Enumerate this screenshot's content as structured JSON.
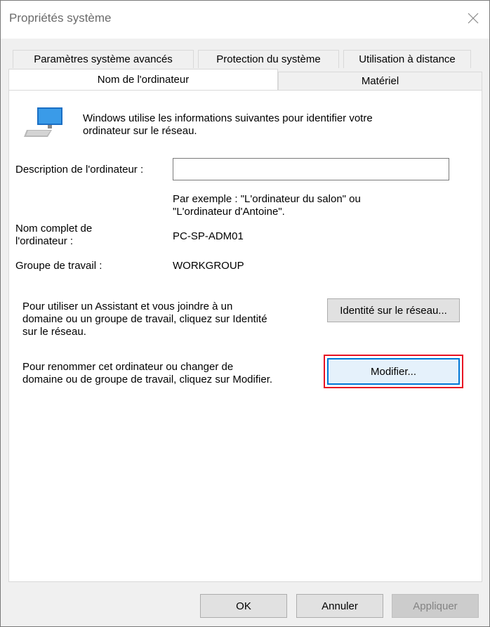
{
  "window": {
    "title": "Propriétés système"
  },
  "tabs": {
    "row1": [
      "Paramètres système avancés",
      "Protection du système",
      "Utilisation à distance"
    ],
    "row2": [
      "Nom de l'ordinateur",
      "Matériel"
    ]
  },
  "panel": {
    "intro_line1": "Windows utilise les informations suivantes pour identifier votre",
    "intro_line2": "ordinateur sur le réseau.",
    "description_label": "Description de l'ordinateur :",
    "description_value": "",
    "example_line1": "Par exemple : \"L'ordinateur du salon\" ou",
    "example_line2": "\"L'ordinateur d'Antoine\".",
    "fullname_label_line1": "Nom complet de",
    "fullname_label_line2": "l'ordinateur :",
    "fullname_value": "PC-SP-ADM01",
    "workgroup_label": "Groupe de travail :",
    "workgroup_value": "WORKGROUP",
    "network_text_line1": "Pour utiliser un Assistant et vous joindre à un",
    "network_text_line2": "domaine ou un groupe de travail, cliquez sur Identité",
    "network_text_line3": "sur le réseau.",
    "network_button": "Identité sur le réseau...",
    "rename_text_line1": "Pour renommer cet ordinateur ou changer de",
    "rename_text_line2": "domaine ou de groupe de travail, cliquez sur Modifier.",
    "modify_button": "Modifier..."
  },
  "footer": {
    "ok": "OK",
    "cancel": "Annuler",
    "apply": "Appliquer"
  },
  "icons": {
    "computer": "computer-monitor-icon",
    "close": "close-icon"
  },
  "colors": {
    "highlight": "#e81123",
    "focus": "#0078d7"
  }
}
